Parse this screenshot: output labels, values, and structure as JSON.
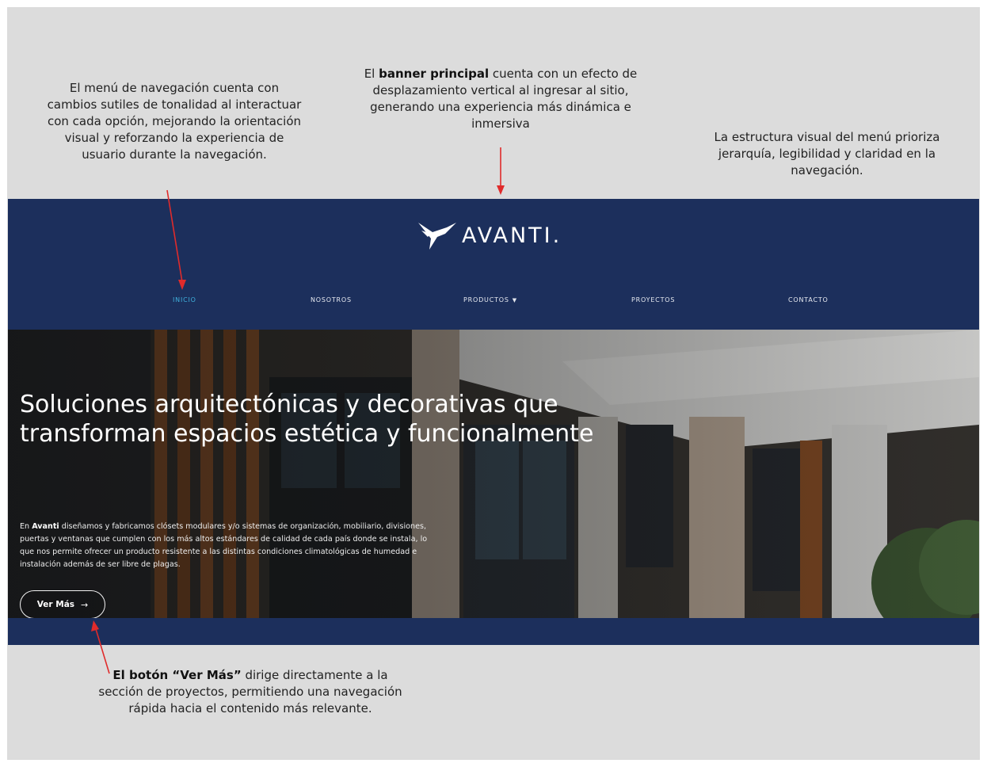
{
  "notes": {
    "nav": "El menú de navegación cuenta con cambios sutiles de tonalidad al interactuar con cada opción, mejorando la orientación visual y reforzando la experiencia de usuario durante la navegación.",
    "banner_bold": "banner principal",
    "banner_pre": "El ",
    "banner_post": " cuenta con un efecto de desplazamiento vertical al ingresar al sitio, generando una experiencia más dinámica e inmersiva",
    "structure": "La estructura visual del menú prioriza jerarquía, legibilidad y claridad en la navegación.",
    "button_bold": "El botón “Ver Más”",
    "button_post": " dirige directamente a la sección de proyectos, permitiendo una navegación rápida hacia el contenido más relevante."
  },
  "site": {
    "logo_text": "AVANTI.",
    "nav": {
      "inicio": "INICIO",
      "nosotros": "NOSOTROS",
      "productos": "PRODUCTOS",
      "proyectos": "PROYECTOS",
      "contacto": "CONTACTO"
    },
    "hero": {
      "title": "Soluciones arquitectónicas y decorativas que transforman espacios estética y funcionalmente",
      "body_pre": "En ",
      "body_brand": "Avanti",
      "body_post": " diseñamos y fabricamos clósets modulares y/o sistemas de organización, mobiliario, divisiones, puertas y ventanas que cumplen con los más altos estándares de calidad de cada país donde se instala, lo que nos permite ofrecer un producto resistente a las distintas condiciones climatológicas de humedad e instalación además de ser libre de plagas.",
      "cta_label": "Ver Más",
      "cta_arrow": "→"
    }
  },
  "colors": {
    "navy": "#1c2f5c",
    "active_nav": "#3fb0dc",
    "annotation_arrow": "#e02b2b",
    "board_bg": "#dcdcdc"
  }
}
